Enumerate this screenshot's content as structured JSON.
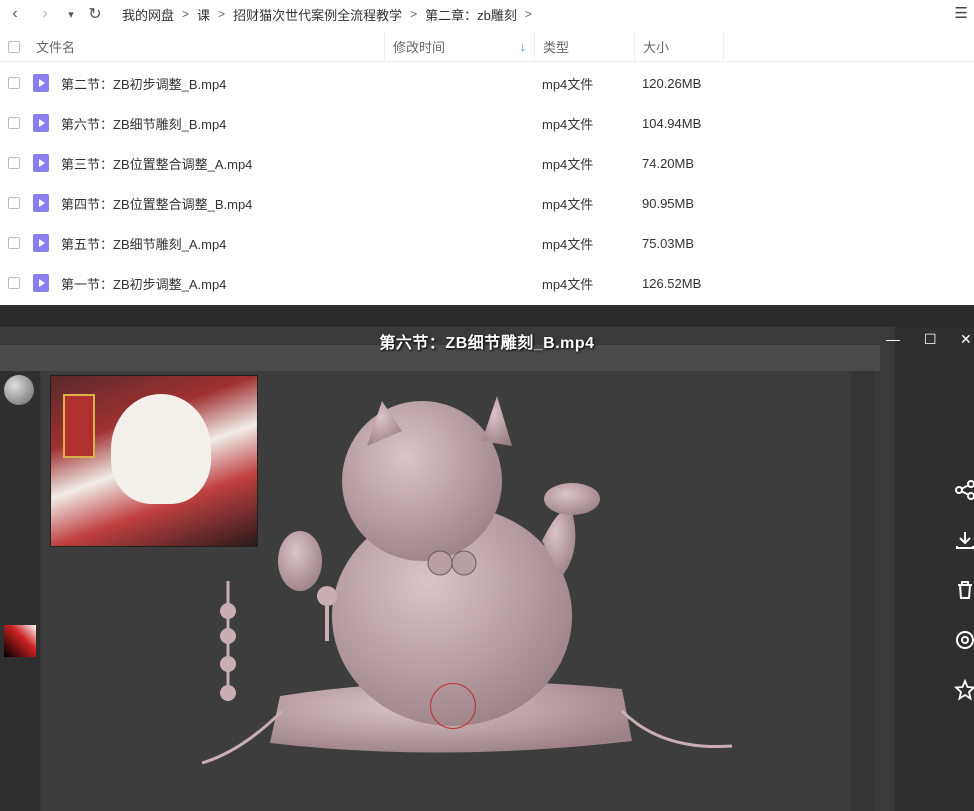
{
  "nav": {
    "back_icon": "‹",
    "forward_icon": "›",
    "dropdown_icon": "▾",
    "refresh_icon": "↻",
    "breadcrumbs": [
      "我的网盘",
      "课",
      "招财猫次世代案例全流程教学",
      "第二章：zb雕刻"
    ],
    "separator": ">",
    "list_view_icon": "☰"
  },
  "table": {
    "columns": {
      "name": "文件名",
      "modified": "修改时间",
      "type": "类型",
      "size": "大小"
    },
    "sort_indicator": "↓",
    "rows": [
      {
        "name": "第二节：ZB初步调整_B.mp4",
        "type": "mp4文件",
        "size": "120.26MB"
      },
      {
        "name": "第六节：ZB细节雕刻_B.mp4",
        "type": "mp4文件",
        "size": "104.94MB"
      },
      {
        "name": "第三节：ZB位置整合调整_A.mp4",
        "type": "mp4文件",
        "size": "74.20MB"
      },
      {
        "name": "第四节：ZB位置整合调整_B.mp4",
        "type": "mp4文件",
        "size": "90.95MB"
      },
      {
        "name": "第五节：ZB细节雕刻_A.mp4",
        "type": "mp4文件",
        "size": "75.03MB"
      },
      {
        "name": "第一节：ZB初步调整_A.mp4",
        "type": "mp4文件",
        "size": "126.52MB"
      }
    ]
  },
  "video": {
    "title": "第六节：ZB细节雕刻_B.mp4",
    "minimize_icon": "—",
    "maximize_icon": "☐",
    "close_icon": "✕",
    "side_icons": [
      "share-icon",
      "download-icon",
      "delete-icon",
      "more-icon",
      "star-icon"
    ]
  },
  "colors": {
    "file_icon": "#8a7ef0",
    "sort_arrow": "#3a8ee6",
    "video_bg": "#3a3a3a",
    "model": "#c9aeb3"
  }
}
